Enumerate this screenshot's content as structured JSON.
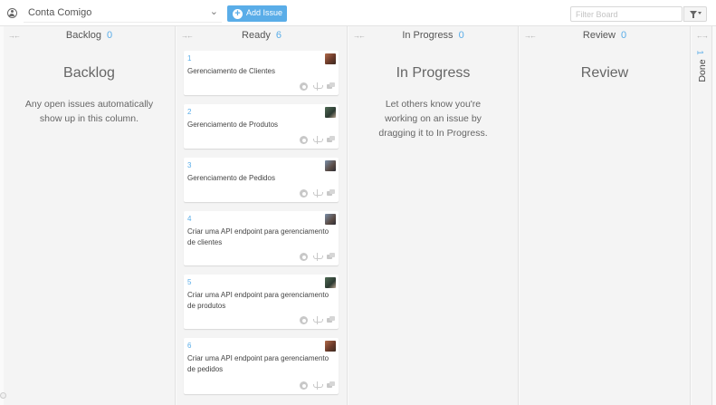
{
  "topbar": {
    "repo_name": "Conta Comigo",
    "repo_caret": "⌄",
    "add_issue_label": "Add Issue",
    "filter_placeholder": "Filter Board"
  },
  "columns": {
    "backlog": {
      "title": "Backlog",
      "count": "0",
      "empty_title": "Backlog",
      "empty_text": "Any open issues automatically show up in this column."
    },
    "ready": {
      "title": "Ready",
      "count": "6"
    },
    "in_progress": {
      "title": "In Progress",
      "count": "0",
      "empty_title": "In Progress",
      "empty_text": "Let others know you're working on an issue by dragging it to In Progress."
    },
    "review": {
      "title": "Review",
      "count": "0",
      "empty_title": "Review"
    },
    "done": {
      "title": "Done",
      "count": "1"
    }
  },
  "cards": [
    {
      "number": "1",
      "title": "Gerenciamento de Clientes"
    },
    {
      "number": "2",
      "title": "Gerenciamento de Produtos"
    },
    {
      "number": "3",
      "title": "Gerenciamento de Pedidos"
    },
    {
      "number": "4",
      "title": "Criar uma API endpoint para gerenciamento de clientes"
    },
    {
      "number": "5",
      "title": "Criar uma API endpoint para gerenciamento de produtos"
    },
    {
      "number": "6",
      "title": "Criar uma API endpoint para gerenciamento de pedidos"
    }
  ],
  "icons": {
    "collapse": "collapse-icon",
    "expand": "expand-icon",
    "github": "github-icon",
    "scale": "scale-icon",
    "comment": "comment-icon"
  },
  "colors": {
    "accent": "#5aade8",
    "column_bg": "#f4f4f4"
  }
}
